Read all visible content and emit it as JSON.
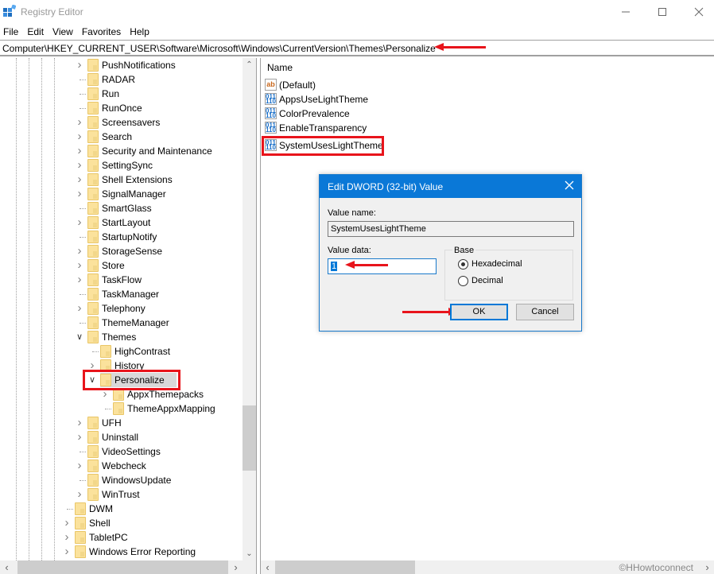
{
  "window": {
    "title": "Registry Editor",
    "controls": {
      "minimize": "—",
      "maximize": "☐",
      "close": "✕"
    }
  },
  "menu": [
    "File",
    "Edit",
    "View",
    "Favorites",
    "Help"
  ],
  "address": {
    "path": "Computer\\HKEY_CURRENT_USER\\Software\\Microsoft\\Windows\\CurrentVersion\\Themes\\Personalize"
  },
  "tree": {
    "items": [
      {
        "label": "PushNotifications",
        "expander": "collapsed"
      },
      {
        "label": "RADAR",
        "expander": "none"
      },
      {
        "label": "Run",
        "expander": "none"
      },
      {
        "label": "RunOnce",
        "expander": "none"
      },
      {
        "label": "Screensavers",
        "expander": "collapsed"
      },
      {
        "label": "Search",
        "expander": "collapsed"
      },
      {
        "label": "Security and Maintenance",
        "expander": "collapsed"
      },
      {
        "label": "SettingSync",
        "expander": "collapsed"
      },
      {
        "label": "Shell Extensions",
        "expander": "collapsed"
      },
      {
        "label": "SignalManager",
        "expander": "collapsed"
      },
      {
        "label": "SmartGlass",
        "expander": "none"
      },
      {
        "label": "StartLayout",
        "expander": "collapsed"
      },
      {
        "label": "StartupNotify",
        "expander": "none"
      },
      {
        "label": "StorageSense",
        "expander": "collapsed"
      },
      {
        "label": "Store",
        "expander": "collapsed"
      },
      {
        "label": "TaskFlow",
        "expander": "collapsed"
      },
      {
        "label": "TaskManager",
        "expander": "none"
      },
      {
        "label": "Telephony",
        "expander": "collapsed"
      },
      {
        "label": "ThemeManager",
        "expander": "none"
      },
      {
        "label": "Themes",
        "expander": "expanded"
      },
      {
        "label": "HighContrast",
        "expander": "none"
      },
      {
        "label": "History",
        "expander": "collapsed"
      },
      {
        "label": "Personalize",
        "expander": "expanded",
        "selected": true
      },
      {
        "label": "AppxThemepacks",
        "expander": "collapsed"
      },
      {
        "label": "ThemeAppxMapping",
        "expander": "none"
      },
      {
        "label": "UFH",
        "expander": "collapsed"
      },
      {
        "label": "Uninstall",
        "expander": "collapsed"
      },
      {
        "label": "VideoSettings",
        "expander": "none"
      },
      {
        "label": "Webcheck",
        "expander": "collapsed"
      },
      {
        "label": "WindowsUpdate",
        "expander": "none"
      },
      {
        "label": "WinTrust",
        "expander": "collapsed"
      },
      {
        "label": "DWM",
        "expander": "none"
      },
      {
        "label": "Shell",
        "expander": "collapsed"
      },
      {
        "label": "TabletPC",
        "expander": "collapsed"
      },
      {
        "label": "Windows Error Reporting",
        "expander": "collapsed"
      }
    ]
  },
  "values": {
    "column_name": "Name",
    "items": [
      {
        "name": "(Default)",
        "type": "string"
      },
      {
        "name": "AppsUseLightTheme",
        "type": "dword"
      },
      {
        "name": "ColorPrevalence",
        "type": "dword"
      },
      {
        "name": "EnableTransparency",
        "type": "dword"
      },
      {
        "name": "SystemUsesLightTheme",
        "type": "dword",
        "highlighted": true
      }
    ]
  },
  "dialog": {
    "title": "Edit DWORD (32-bit) Value",
    "value_name_label": "Value name:",
    "value_name": "SystemUsesLightTheme",
    "value_data_label": "Value data:",
    "value_data": "1",
    "base_label": "Base",
    "base_options": [
      {
        "label": "Hexadecimal",
        "checked": true
      },
      {
        "label": "Decimal",
        "checked": false
      }
    ],
    "ok_label": "OK",
    "cancel_label": "Cancel"
  },
  "watermark": "©HHowtoconnect",
  "accent_colors": {
    "annotation_red": "#e8141b",
    "dialog_title_blue": "#0a78d7"
  }
}
